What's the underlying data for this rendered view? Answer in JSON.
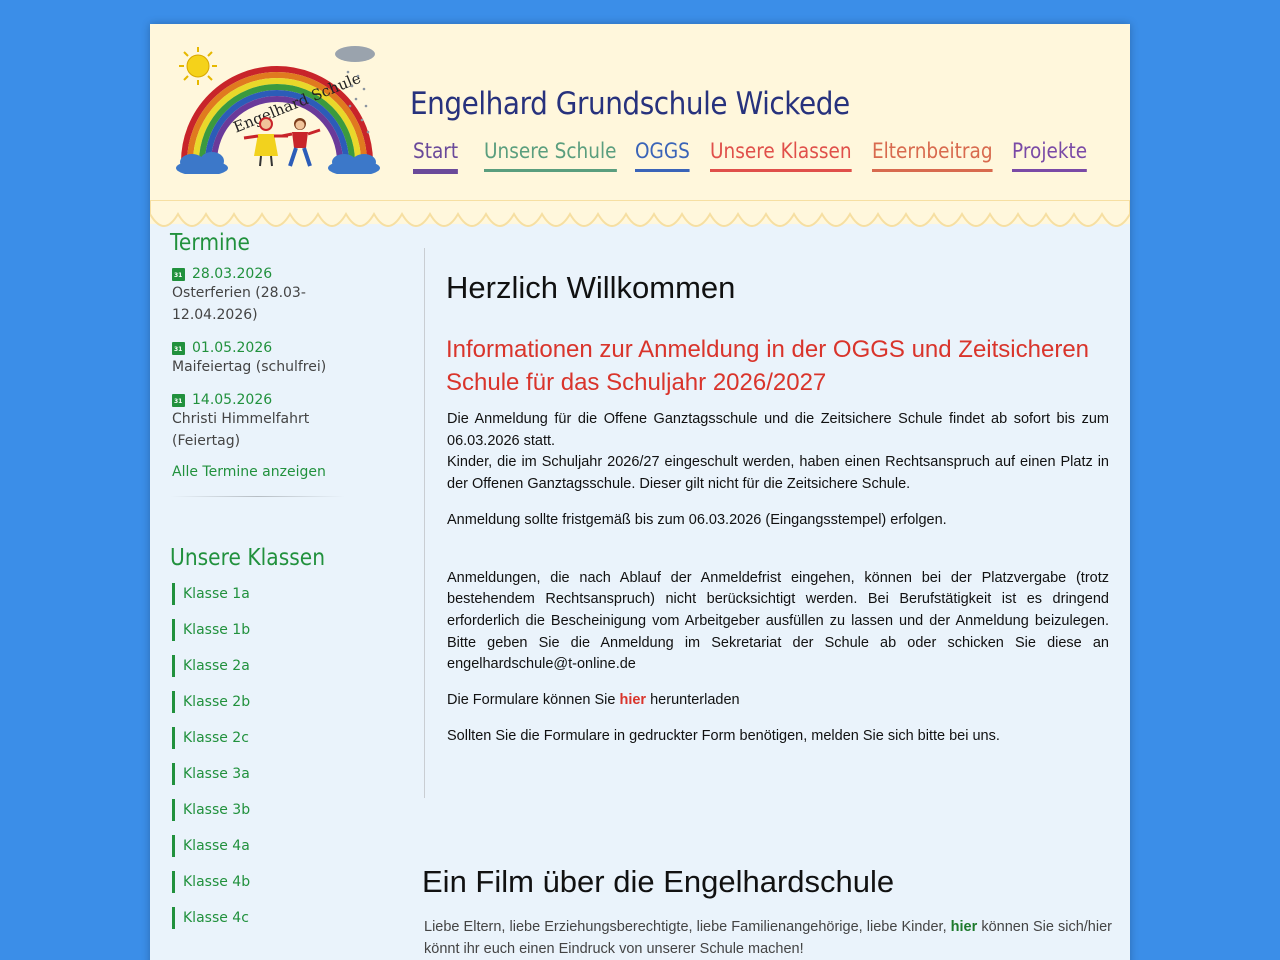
{
  "header": {
    "logo_text": "Engelhard Schule",
    "title": "Engelhard Grundschule Wickede",
    "nav": [
      {
        "label": "Start",
        "color": "#6a4a9a"
      },
      {
        "label": "Unsere Schule",
        "color": "#5a9e7e"
      },
      {
        "label": "OGGS",
        "color": "#3a64b8"
      },
      {
        "label": "Unsere Klassen",
        "color": "#e0504a"
      },
      {
        "label": "Elternbeitrag",
        "color": "#d86a4e"
      },
      {
        "label": "Projekte",
        "color": "#7a4aa6"
      }
    ]
  },
  "sidebar": {
    "termine_title": "Termine",
    "events": [
      {
        "date": "28.03.2026",
        "text": "Osterferien (28.03-12.04.2026)"
      },
      {
        "date": "01.05.2026",
        "text": "Maifeiertag (schulfrei)"
      },
      {
        "date": "14.05.2026",
        "text": "Christi Himmelfahrt (Feiertag)"
      }
    ],
    "all_link": "Alle Termine anzeigen",
    "klassen_title": "Unsere Klassen",
    "klassen": [
      "Klasse 1a",
      "Klasse 1b",
      "Klasse 2a",
      "Klasse 2b",
      "Klasse 2c",
      "Klasse 3a",
      "Klasse 3b",
      "Klasse 4a",
      "Klasse 4b",
      "Klasse 4c"
    ]
  },
  "main": {
    "welcome": "Herzlich Willkommen",
    "info_heading": "Informationen zur Anmeldung in der OGGS und Zeitsicheren Schule für das Schuljahr 2026/2027",
    "p1_line1": "Die Anmeldung für die Offene Ganztagsschule und die Zeitsichere Schule findet ab  sofort bis zum 06.03.2026 statt.",
    "p1_line2": "Kinder, die im Schuljahr 2026/27 eingeschult werden, haben einen Rechtsanspruch  auf einen Platz in der Offenen Ganztagsschule. Dieser gilt nicht für die Zeitsichere Schule.",
    "p2": "Anmeldung sollte fristgemäß bis zum 06.03.2026 (Eingangsstempel) erfolgen.",
    "p3": "Anmeldungen, die nach Ablauf der Anmeldefrist eingehen, können bei der  Platzvergabe (trotz bestehendem Rechtsanspruch) nicht berücksichtigt werden.  Bei Berufstätigkeit ist es dringend erforderlich die Bescheinigung vom  Arbeitgeber ausfüllen zu lassen und der Anmeldung beizulegen.  Bitte geben Sie die Anmeldung im Sekretariat der Schule ab oder schicken Sie diese an engelhardschule@t-online.de",
    "p4_before": "Die Formulare können Sie ",
    "p4_link": "hier",
    "p4_after": " herunterladen",
    "p5": "Sollten Sie die Formulare in gedruckter Form benötigen, melden Sie sich bitte bei uns."
  },
  "film": {
    "heading": "Ein Film über die Engelhardschule",
    "text_before": "Liebe Eltern, liebe Erziehungsberechtigte, liebe Familienangehörige, liebe Kinder, ",
    "link": "hier",
    "text_after": " können Sie sich/hier könnt ihr euch einen Eindruck von unserer Schule machen!"
  }
}
